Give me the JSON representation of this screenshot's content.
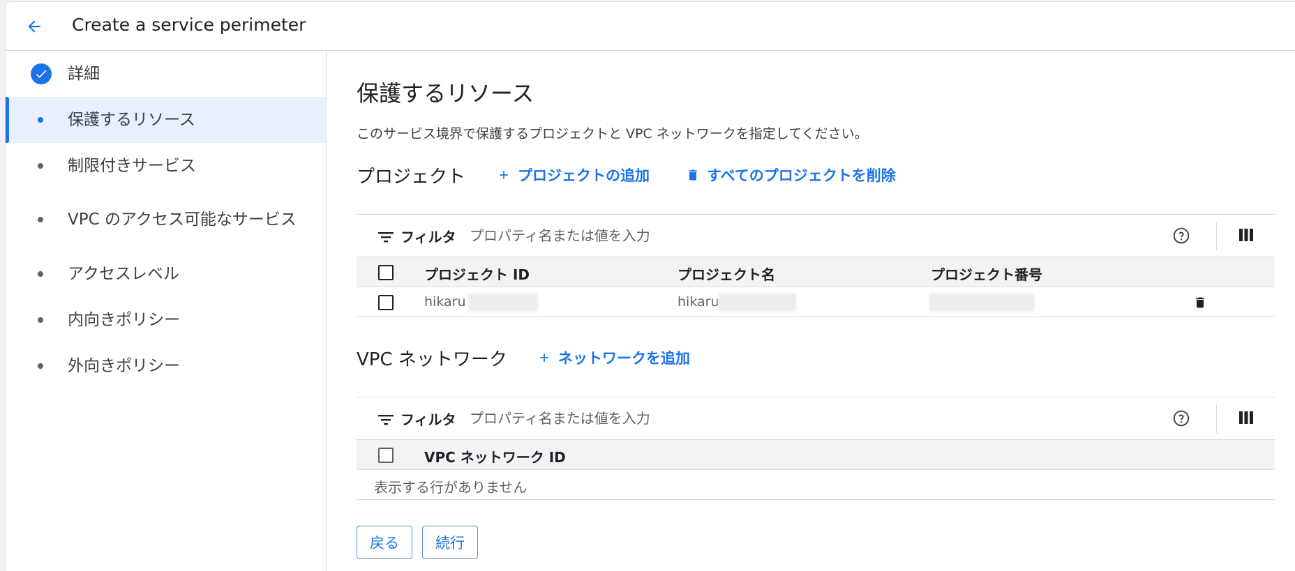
{
  "header": {
    "title": "Create a service perimeter"
  },
  "sidebar": {
    "steps": [
      {
        "label": "詳細",
        "state": "completed"
      },
      {
        "label": "保護するリソース",
        "state": "active"
      },
      {
        "label": "制限付きサービス",
        "state": "pending"
      },
      {
        "label": "VPC のアクセス可能なサービス",
        "state": "pending"
      },
      {
        "label": "アクセスレベル",
        "state": "pending"
      },
      {
        "label": "内向きポリシー",
        "state": "pending"
      },
      {
        "label": "外向きポリシー",
        "state": "pending"
      }
    ]
  },
  "main": {
    "title": "保護するリソース",
    "description": "このサービス境界で保護するプロジェクトと VPC ネットワークを指定してください。",
    "projects": {
      "heading": "プロジェクト",
      "add_label": "プロジェクトの追加",
      "remove_all_label": "すべてのプロジェクトを削除",
      "filter": {
        "label": "フィルタ",
        "placeholder": "プロパティ名または値を入力"
      },
      "columns": [
        "プロジェクト ID",
        "プロジェクト名",
        "プロジェクト番号"
      ],
      "rows": [
        {
          "id": "hikaru",
          "name": "hikaru",
          "number": ""
        }
      ]
    },
    "vpc": {
      "heading": "VPC ネットワーク",
      "add_label": "ネットワークを追加",
      "filter": {
        "label": "フィルタ",
        "placeholder": "プロパティ名または値を入力"
      },
      "columns": [
        "VPC ネットワーク ID"
      ],
      "empty_message": "表示する行がありません"
    },
    "buttons": {
      "back": "戻る",
      "continue": "続行"
    }
  },
  "colors": {
    "accent": "#1a73e8",
    "active_step_bg": "#e8f0fe",
    "border": "#dadce0",
    "header_row_bg": "#f1f3f4"
  },
  "icons": [
    "arrow-back-icon",
    "check-circle-icon",
    "add-icon",
    "delete-icon",
    "filter-icon",
    "help-icon",
    "view-columns-icon"
  ]
}
